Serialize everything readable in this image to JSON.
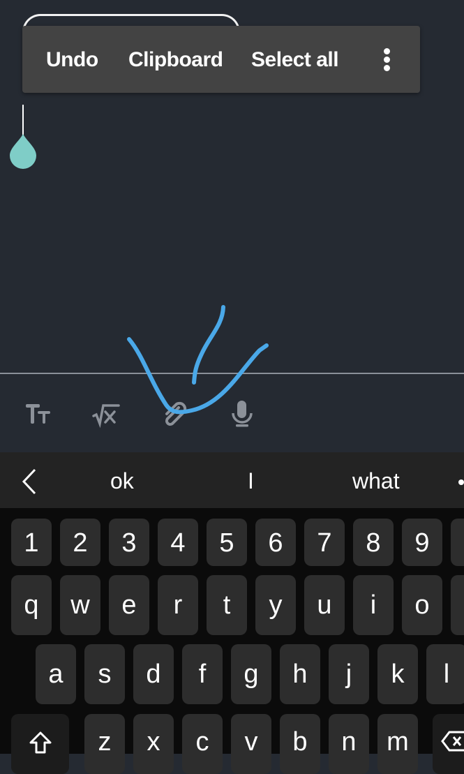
{
  "context_menu": {
    "items": [
      {
        "label": "Undo"
      },
      {
        "label": "Clipboard"
      },
      {
        "label": "Select all"
      }
    ],
    "more_icon": "more-vertical-icon"
  },
  "toolbar": {
    "icons": [
      "text-size-icon",
      "math-formula-icon",
      "attachment-icon",
      "microphone-icon"
    ]
  },
  "suggestions": {
    "back_icon": "chevron-left-icon",
    "words": [
      "ok",
      "I",
      "what"
    ]
  },
  "keyboard": {
    "number_row": [
      "1",
      "2",
      "3",
      "4",
      "5",
      "6",
      "7",
      "8",
      "9"
    ],
    "row_q": [
      "q",
      "w",
      "e",
      "r",
      "t",
      "y",
      "u",
      "i",
      "o"
    ],
    "row_a": [
      "a",
      "s",
      "d",
      "f",
      "g",
      "h",
      "j",
      "k",
      "l"
    ],
    "row_z": [
      "z",
      "x",
      "c",
      "v",
      "b",
      "n",
      "m"
    ],
    "shift_icon": "shift-icon",
    "backspace_icon": "backspace-icon"
  },
  "colors": {
    "background": "#252a32",
    "menu": "#434343",
    "cursor_handle": "#7fcdc7",
    "ink": "#4aa8e8",
    "key": "#2d2d2d",
    "keyboard_bg": "#0b0b0b"
  }
}
